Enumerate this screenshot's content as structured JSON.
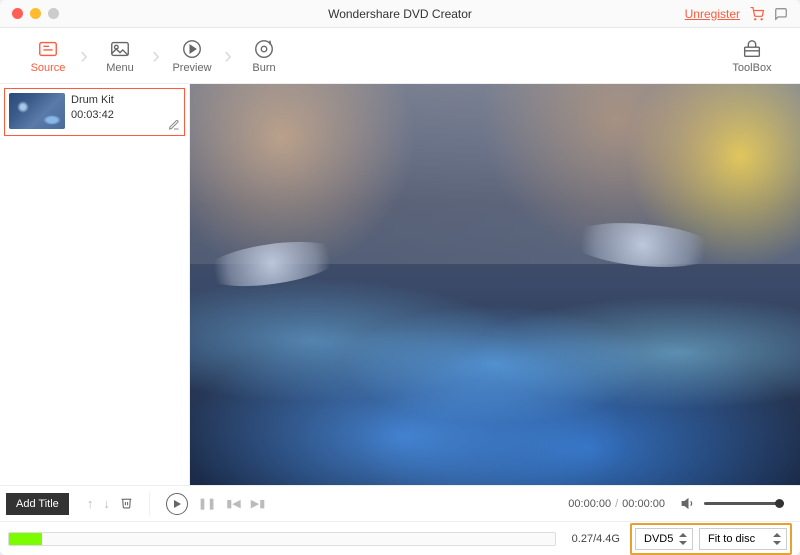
{
  "titlebar": {
    "app_title": "Wondershare DVD Creator",
    "unregister_label": "Unregister"
  },
  "steps": {
    "source": "Source",
    "menu": "Menu",
    "preview": "Preview",
    "burn": "Burn",
    "toolbox": "ToolBox"
  },
  "clip": {
    "title": "Drum Kit",
    "duration": "00:03:42"
  },
  "bottom": {
    "add_title": "Add Title"
  },
  "playback": {
    "current": "00:00:00",
    "total": "00:00:00"
  },
  "status": {
    "size_text": "0.27/4.4G",
    "disc_type": "DVD5",
    "fit": "Fit to disc",
    "progress_percent": 6
  },
  "colors": {
    "accent": "#ff5a3c",
    "highlight_border": "#e8a030"
  }
}
